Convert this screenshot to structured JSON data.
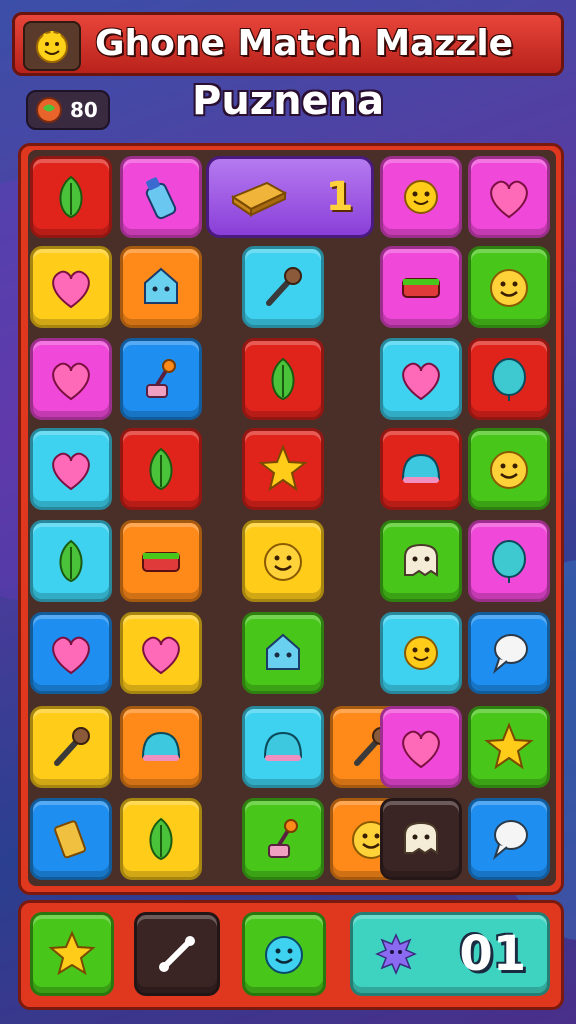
{
  "header": {
    "title_line1": "Ghone Match  Mazzle",
    "title_line2": "Puznena"
  },
  "coins": {
    "count": "80"
  },
  "banner": {
    "count": "1"
  },
  "footer": {
    "score": "01"
  },
  "palette": {
    "red": "#e0241c",
    "pink": "#f048d8",
    "yellow": "#ffcc1a",
    "orange": "#ff8a1a",
    "cyan": "#3ed2f0",
    "blue": "#1e8ef0",
    "green": "#48c61a",
    "purple": "#a05af0"
  },
  "board": {
    "rows": [
      [
        "red:leaf-icon",
        "pink:bottle-icon",
        "banner",
        "banner",
        "banner",
        "pink:sun-face-icon",
        "pink:heart-icon"
      ],
      [
        "yellow:heart-icon",
        "orange:house-blob-icon",
        "empty",
        "cyan:microphone-icon",
        "empty",
        "pink:candy-box-icon",
        "green:face-icon"
      ],
      [
        "pink:heart-icon",
        "blue:joystick-icon",
        "empty",
        "red:leaf-icon",
        "empty",
        "cyan:heart-icon",
        "red:balloon-icon"
      ],
      [
        "cyan:heart-icon",
        "red:leaf-icon",
        "empty",
        "red:star-icon",
        "empty",
        "red:jelly-icon",
        "green:face-icon"
      ],
      [
        "cyan:leaf-icon",
        "orange:candy-box-icon",
        "empty",
        "yellow:face-icon",
        "empty",
        "green:ghost-icon",
        "pink:balloon-icon"
      ],
      [
        "blue:heart-icon",
        "yellow:heart-icon",
        "empty",
        "green:house-blob-icon",
        "empty",
        "cyan:sun-face-icon",
        "blue:speech-bubble-icon"
      ],
      [
        "yellow:microphone-icon",
        "orange:jelly-icon",
        "empty",
        "cyan:jelly-icon",
        "orange:microphone-icon",
        "pink:heart-icon",
        "green:star-icon"
      ],
      [
        "blue:chocolate-icon",
        "yellow:leaf-icon",
        "empty",
        "green:joystick-icon",
        "orange:face-icon",
        "dark:ghost-icon",
        "blue:speech-bubble-icon"
      ]
    ]
  },
  "bottom_buttons": [
    {
      "color": "green",
      "icon": "star-icon"
    },
    {
      "color": "dark",
      "icon": "bone-icon"
    },
    {
      "color": "green",
      "icon": "face-icon"
    },
    {
      "color": "cyan",
      "icon": "sun-face-icon"
    }
  ]
}
